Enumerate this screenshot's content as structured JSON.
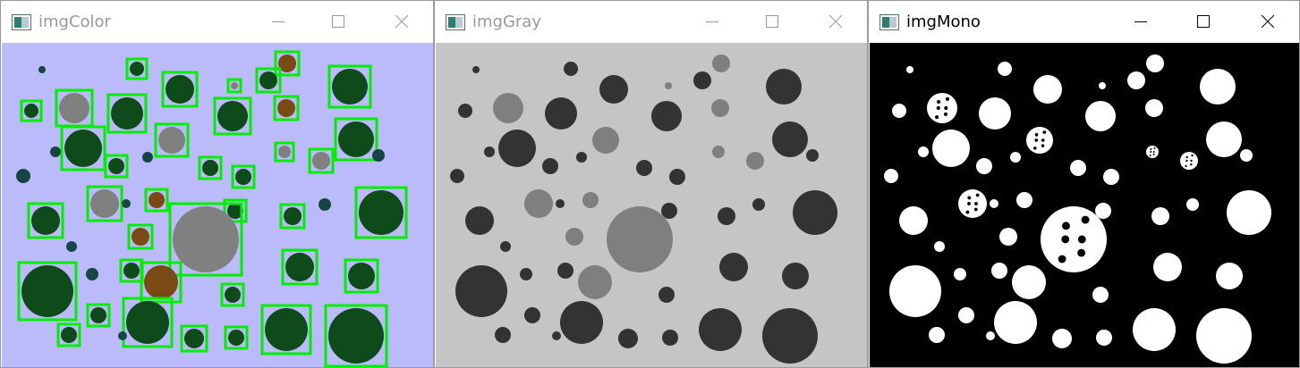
{
  "windows": [
    {
      "title": "imgColor",
      "background": "#bbbbfb",
      "active": false
    },
    {
      "title": "imgGray",
      "background": "#c5c5c5",
      "active": false
    },
    {
      "title": "imgMono",
      "background": "#000000",
      "active": true
    }
  ],
  "icons": {
    "app": "image-window-icon",
    "minimize": "minimize-icon",
    "maximize": "maximize-icon",
    "close": "close-icon"
  },
  "colors": {
    "dark_blob": "#0f4a1a",
    "gray_blob": "#808080",
    "brown_blob": "#7a4a14",
    "small_dot": "#174545",
    "bbox": "#00ee00",
    "gray_dark": "#333333",
    "gray_mid": "#7f7f7f",
    "mono_fg": "#ffffff"
  }
}
